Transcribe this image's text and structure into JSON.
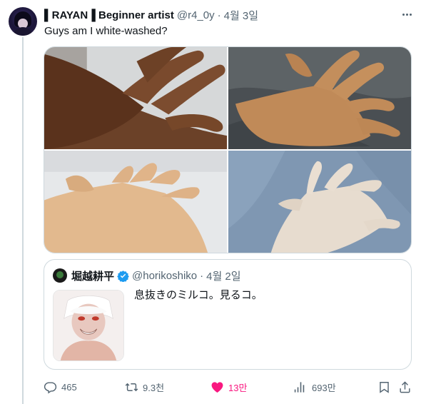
{
  "tweet": {
    "display_name": "▌RAYAN▐ Beginner artist",
    "handle": "@r4_0y",
    "separator": "·",
    "date": "4월 3일",
    "text": "Guys am I white-washed?",
    "more_icon": "more-horizontal-icon"
  },
  "quote": {
    "display_name": "堀越耕平",
    "verified": true,
    "handle": "@horikoshiko",
    "separator": "·",
    "date": "4월 2일",
    "text": "息抜きのミルコ。見るコ。"
  },
  "actions": {
    "replies": "465",
    "retweets": "9.3천",
    "likes": "13만",
    "views": "693만"
  },
  "colors": {
    "text": "#0f1419",
    "muted": "#536471",
    "border": "#cfd9de",
    "like_pink": "#f91880",
    "verified_blue": "#1d9bf0"
  }
}
